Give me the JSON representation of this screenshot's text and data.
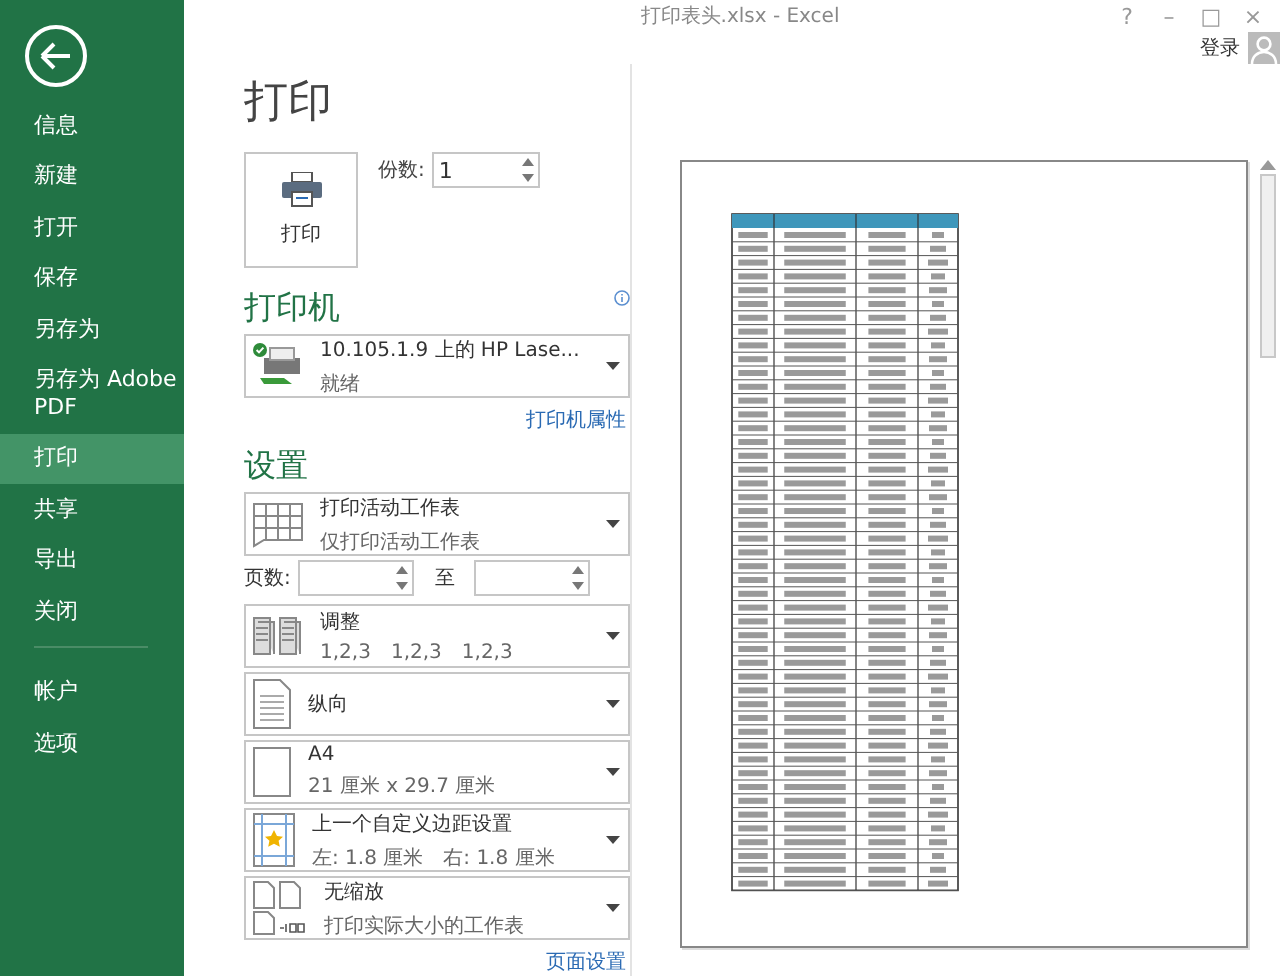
{
  "window": {
    "title": "打印表头.xlsx - Excel",
    "buttons": [
      "?",
      "–",
      "□",
      "×"
    ]
  },
  "account": {
    "sign_in": "登录"
  },
  "nav": {
    "items": [
      {
        "label": "信息",
        "selected": false
      },
      {
        "label": "新建",
        "selected": false
      },
      {
        "label": "打开",
        "selected": false
      },
      {
        "label": "保存",
        "selected": false
      },
      {
        "label": "另存为",
        "selected": false
      },
      {
        "label": "另存为 Adobe PDF",
        "selected": false
      },
      {
        "label": "打印",
        "selected": true
      },
      {
        "label": "共享",
        "selected": false
      },
      {
        "label": "导出",
        "selected": false
      },
      {
        "label": "关闭",
        "selected": false
      }
    ],
    "bottom_items": [
      {
        "label": "帐户",
        "selected": false
      },
      {
        "label": "选项",
        "selected": false
      }
    ]
  },
  "print": {
    "heading": "打印",
    "print_button": "打印",
    "copies_label": "份数:",
    "copies_value": "1"
  },
  "printer": {
    "heading": "打印机",
    "name": "10.105.1.9 上的 HP Lase...",
    "status": "就绪",
    "properties_link": "打印机属性"
  },
  "settings": {
    "heading": "设置",
    "items": [
      {
        "kind": "sheet",
        "title": "打印活动工作表",
        "lines": [
          "仅打印活动工作表"
        ]
      },
      {
        "kind": "pages",
        "label": "页数:",
        "to_label": "至"
      },
      {
        "kind": "collate",
        "title": "调整",
        "lines": [
          "1,2,3",
          "1,2,3",
          "1,2,3"
        ]
      },
      {
        "kind": "portrait",
        "title": "纵向"
      },
      {
        "kind": "paper",
        "title": "A4",
        "lines": [
          "21 厘米 x 29.7 厘米"
        ]
      },
      {
        "kind": "margins",
        "title": "上一个自定义边距设置",
        "lines": [
          "左: 1.8 厘米",
          "右: 1.8 厘米"
        ]
      },
      {
        "kind": "scaling",
        "title": "无缩放",
        "lines": [
          "打印实际大小的工作表"
        ]
      }
    ],
    "page_setup_link": "页面设置"
  }
}
